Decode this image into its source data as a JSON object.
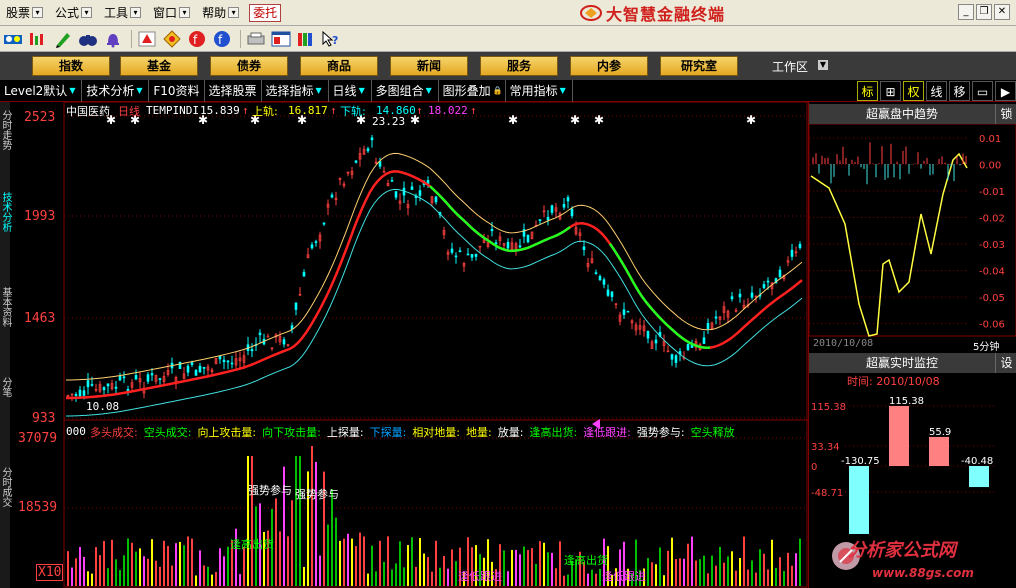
{
  "menubar": {
    "items": [
      "股票",
      "公式",
      "工具",
      "窗口",
      "帮助"
    ],
    "weituo": "委托",
    "app_title": "大智慧金融终端"
  },
  "navbar": {
    "buttons": [
      "指数",
      "基金",
      "债券",
      "商品",
      "新闻",
      "服务",
      "内参",
      "研究室"
    ],
    "workarea": "工作区"
  },
  "tabbar": {
    "tabs": [
      "Level2默认",
      "技术分析",
      "F10资料",
      "选择股票",
      "选择指标",
      "日线",
      "多图组合",
      "图形叠加",
      "常用指标"
    ],
    "right_tabs": [
      "标",
      "⊞",
      "权",
      "线",
      "移"
    ]
  },
  "sidetabs": [
    "分时走势",
    "技术分析",
    "基本资料",
    "分笔",
    "分时成交"
  ],
  "chart": {
    "stock_name": "中国医药",
    "period": "日线",
    "indicator": "TEMPINDI",
    "indicator_value": "15.839",
    "upper_label": "上轨:",
    "upper_value": "16.817",
    "lower_label": "下轨:",
    "lower_value": "14.860",
    "extra_value": "18.022",
    "high_marker": "23.23",
    "low_marker": "10.08",
    "price_axis": [
      "2523",
      "1993",
      "1463",
      "933"
    ],
    "vol_axis": [
      "37079",
      "18539"
    ],
    "vol_unit": "X10",
    "vol_prefix": "000",
    "vol_legend": [
      {
        "text": "多头成交:",
        "color": "#ff4040"
      },
      {
        "text": "空头成交:",
        "color": "#00ff00"
      },
      {
        "text": "向上攻击量:",
        "color": "#ffff00"
      },
      {
        "text": "向下攻击量:",
        "color": "#00ff00"
      },
      {
        "text": "上探量:",
        "color": "#ffffff"
      },
      {
        "text": "下探量:",
        "color": "#00a0ff"
      },
      {
        "text": "相对地量:",
        "color": "#ffff00"
      },
      {
        "text": "地量:",
        "color": "#ffff00"
      },
      {
        "text": "放量:",
        "color": "#ffffff"
      },
      {
        "text": "逢高出货:",
        "color": "#00ff00"
      },
      {
        "text": "逢低跟进:",
        "color": "#ff40ff"
      },
      {
        "text": "强势参与:",
        "color": "#ffffff"
      },
      {
        "text": "空头释放",
        "color": "#00ff00"
      }
    ],
    "annotations": {
      "strong1": "强势参与",
      "strong2": "强势参与",
      "sell_high1": "逢高出货",
      "sell_high2": "逢高出货",
      "buy_low1": "逢低跟进",
      "buy_low2": "逢低跟进"
    }
  },
  "rpanel": {
    "trend_title": "超赢盘中趋势",
    "lock": "锁",
    "trend_axis": [
      "0.01",
      "0.00",
      "-0.01",
      "-0.02",
      "-0.03",
      "-0.04",
      "-0.05",
      "-0.06"
    ],
    "trend_date": "2010/10/08",
    "trend_period": "5分钟",
    "monitor_title": "超赢实时监控",
    "settings": "设",
    "monitor_time": "时间: 2010/10/08",
    "monitor_axis": [
      "115.38",
      "33.34",
      "0",
      "-48.71"
    ],
    "bars": [
      {
        "label": "-130.75",
        "value": -130.75,
        "color": "#80ffff"
      },
      {
        "label": "115.38",
        "value": 115.38,
        "color": "#ff8080"
      },
      {
        "label": "55.9",
        "value": 55.9,
        "color": "#ff8080"
      },
      {
        "label": "-40.48",
        "value": -40.48,
        "color": "#80ffff"
      }
    ]
  },
  "watermark": {
    "text": "分析家公式网",
    "url": "www.88gs.com"
  }
}
